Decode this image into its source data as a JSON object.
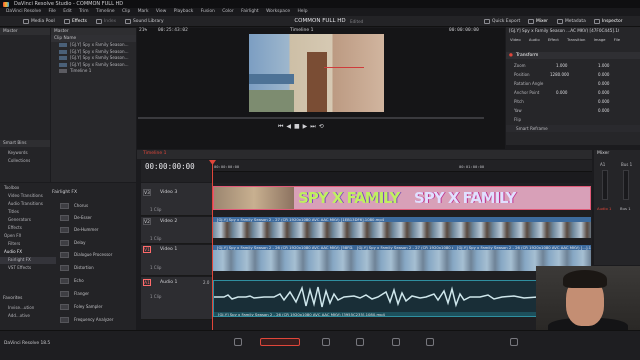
{
  "window_title": "DaVinci Resolve Studio - COMMON FULL HD",
  "menu": [
    "DaVinci Resolve",
    "File",
    "Edit",
    "Trim",
    "Timeline",
    "Clip",
    "Mark",
    "View",
    "Playback",
    "Fusion",
    "Color",
    "Fairlight",
    "Workspace",
    "Help"
  ],
  "toolbar": {
    "left": [
      "Media Pool",
      "Effects",
      "Index",
      "Sound Library"
    ],
    "project_title": "COMMON FULL HD",
    "edited": "Edited",
    "right": [
      "Quick Export",
      "Mixer",
      "Metadata",
      "Inspector"
    ]
  },
  "media_pool": {
    "master_label": "Master",
    "column_header": "Clip Name",
    "clips": [
      "[GJ.Y] Spy x Family Season...",
      "[GJ.Y] Spy x Family Season...",
      "[GJ.Y] Spy x Family Season...",
      "[GJ.Y] Spy x Family Season...",
      "Timeline 1"
    ],
    "smart_bins_label": "Smart Bins",
    "smart_bins": [
      "Keywords",
      "Collections"
    ]
  },
  "viewer": {
    "zoom": "21%",
    "source_timecode": "00:25:43:02",
    "timeline_name": "Timeline 1",
    "right_timecode": "00:00:00:00"
  },
  "effects_panel": {
    "toolbox_items": [
      "Toolbox",
      "Video Transitions",
      "Audio Transitions",
      "Titles",
      "Generators",
      "Effects",
      "Open FX",
      "Filters",
      "Audio FX",
      "Fairlight FX",
      "VST Effects"
    ],
    "favorites_label": "Favorites",
    "favorites": [
      "Invise...ution",
      "Add...xtive"
    ],
    "section_title": "Fairlight FX",
    "fx_items": [
      "Chorus",
      "De-Esser",
      "De-Hummer",
      "Delay",
      "Dialogue Processor",
      "Distortion",
      "Echo",
      "Flanger",
      "Foley Sampler",
      "Frequency Analyzer"
    ]
  },
  "timeline": {
    "name": "Timeline 1",
    "timecode": "00:00:00:00",
    "ruler_marks": [
      "00:00:00:00",
      "00:01:00:00"
    ],
    "tracks": [
      {
        "id": "V3",
        "name": "Video 3",
        "clips": "1 Clip"
      },
      {
        "id": "V2",
        "name": "Video 2",
        "clips": "1 Clip"
      },
      {
        "id": "V1",
        "name": "Video 1",
        "clips": "1 Clip"
      },
      {
        "id": "A1",
        "name": "Audio 1",
        "clips": "1 Clip",
        "level": "2.0"
      }
    ],
    "clip_labels": {
      "v2": "[GJ.Y] Spy x Family Season 2 - 27 (CR 1920x1080 AVC AAC MKV) [1EB13DF6].1080.mp4",
      "v1_a": "[GJ.Y] Spy x Family Season 2 - 26 (CR 1920x1080 AVC AAC MKV) [58FD...].1080.mp4",
      "v1_b": "[GJ.Y] Spy x Family Season 2 - 27 (CR 1920x1080 AVC AAC MKV) [CE4DB6E0].1080.mp4",
      "v1_c": "[GJ.Y] Spy x Family Season 2 - 26 (CR 1920x1080 AVC AAC MKV) [...].1080.mp4",
      "a1": "[GJ.Y] Spy x Family Season 2 - 26 (CR 1920x1080 AVC AAC MKV) [3955C235].1080.mp4"
    },
    "v3_title": "SPY X FAMILY"
  },
  "inspector": {
    "clip_title": "[GJ.Y] Spy x Family Season ...AC MKV) [47F0C445].1080.mp4",
    "tabs": [
      "Video",
      "Audio",
      "Effect",
      "Transition",
      "Image",
      "File"
    ],
    "section": "Transform",
    "props": [
      {
        "label": "Zoom",
        "x": "1.000",
        "y": "1.000"
      },
      {
        "label": "Position",
        "x": "1280.000",
        "y": "0.000"
      },
      {
        "label": "Rotation Angle",
        "x": "0.000",
        "y": ""
      },
      {
        "label": "Anchor Point",
        "x": "0.000",
        "y": "0.000"
      },
      {
        "label": "Pitch",
        "x": "0.000",
        "y": ""
      },
      {
        "label": "Yaw",
        "x": "0.000",
        "y": ""
      },
      {
        "label": "Flip",
        "x": "",
        "y": ""
      }
    ],
    "smart_reframe": "Smart Reframe"
  },
  "mixer": {
    "title": "Mixer",
    "channels": [
      "A1",
      "Bus 1"
    ],
    "bottom": [
      "Audio 1",
      "Bus 1"
    ]
  },
  "status": {
    "app_label": "DaVinci Resolve 18.5"
  },
  "colors": {
    "accent_red": "#e0463a",
    "clip_blue": "#3d6b9e",
    "audio_teal": "#2f8fa0"
  }
}
